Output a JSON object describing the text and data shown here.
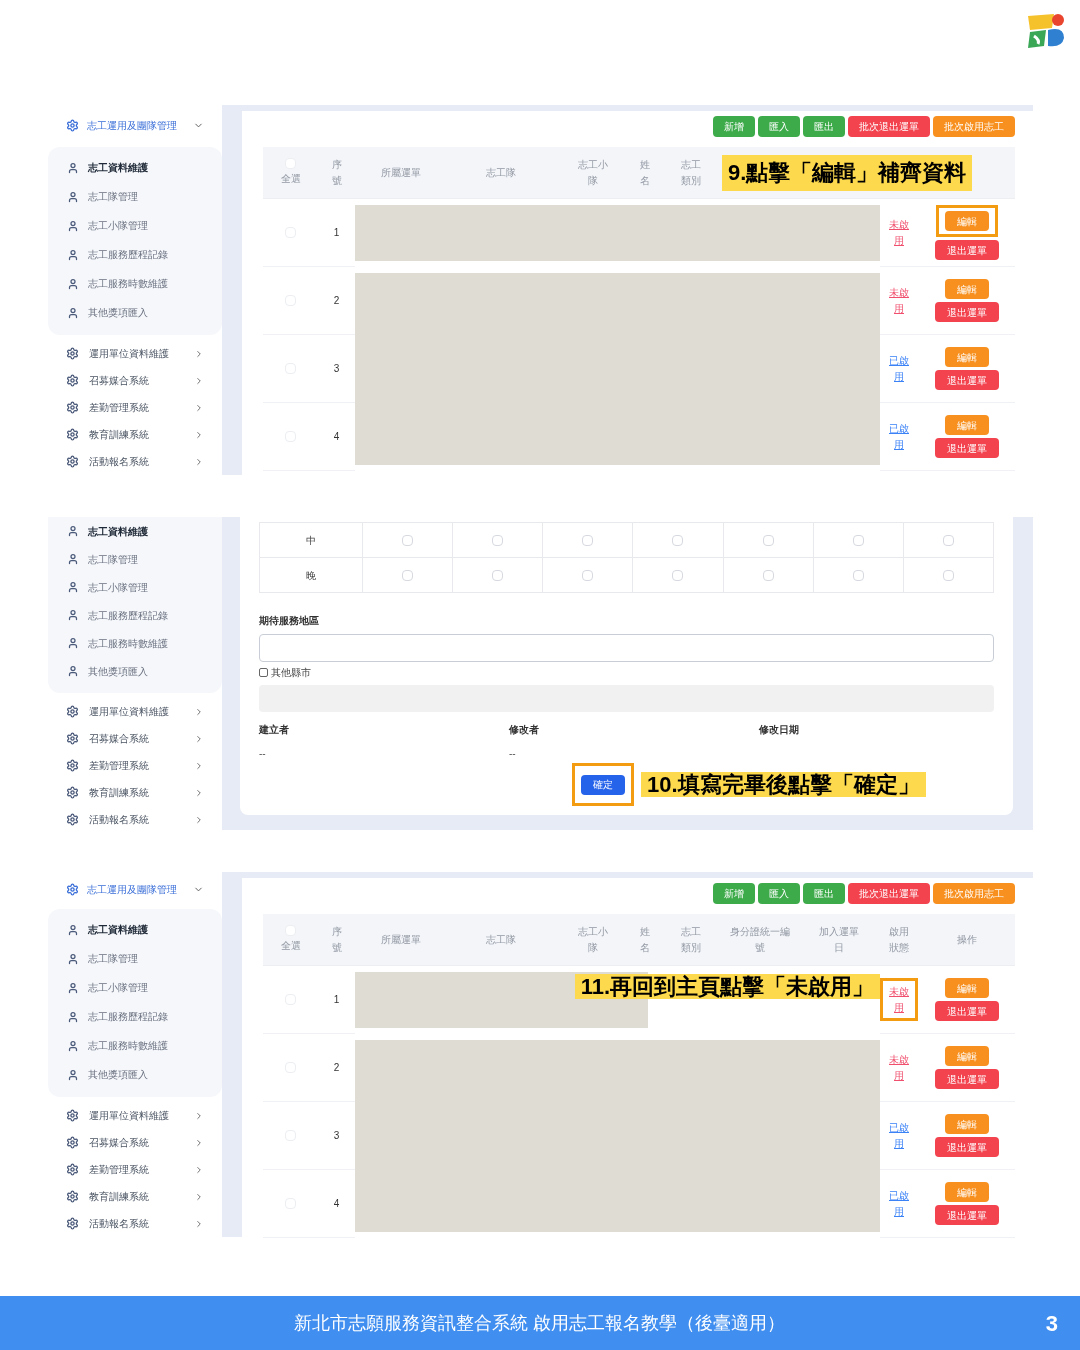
{
  "screenshot_1": {
    "sidebar": {
      "group": {
        "label": "志工運用及團隊管理",
        "expanded": true
      },
      "items": [
        {
          "label": "志工資料維護",
          "selected": true
        },
        {
          "label": "志工隊管理",
          "selected": false
        },
        {
          "label": "志工小隊管理",
          "selected": false
        },
        {
          "label": "志工服務歷程記錄",
          "selected": false
        },
        {
          "label": "志工服務時數維護",
          "selected": false
        },
        {
          "label": "其他獎項匯入",
          "selected": false
        }
      ],
      "other_groups": [
        {
          "label": "運用單位資料維護",
          "expanded": false
        },
        {
          "label": "召募媒合系統",
          "expanded": false
        },
        {
          "label": "差勤管理系統",
          "expanded": false
        },
        {
          "label": "教育訓練系統",
          "expanded": false
        },
        {
          "label": "活動報名系統",
          "expanded": false
        }
      ]
    },
    "toolbar": [
      {
        "label": "新增",
        "kind": "success"
      },
      {
        "label": "匯入",
        "kind": "success"
      },
      {
        "label": "匯出",
        "kind": "success"
      },
      {
        "label": "批次退出運單",
        "kind": "danger"
      },
      {
        "label": "批次啟用志工",
        "kind": "warning"
      }
    ],
    "table": {
      "columns": [
        {
          "label": "全選",
          "kind": "select_all",
          "checked": false
        },
        {
          "label": "序號"
        },
        {
          "label": "所屬運單"
        },
        {
          "label": "志工隊"
        },
        {
          "label": "志工小隊"
        },
        {
          "label": "姓名"
        },
        {
          "label": "志工類別"
        }
      ],
      "header_callout": "9.點擊「編輯」補齊資料",
      "rows": [
        {
          "number": "1",
          "checked": false,
          "status": "未啟用",
          "enabled": false,
          "edit_highlighted": true,
          "status_highlighted": false,
          "actions": [
            {
              "label": "編輯",
              "kind": "warning"
            },
            {
              "label": "退出運單",
              "kind": "danger"
            }
          ]
        },
        {
          "number": "2",
          "checked": false,
          "status": "未啟用",
          "enabled": false,
          "edit_highlighted": false,
          "status_highlighted": false,
          "actions": [
            {
              "label": "編輯",
              "kind": "warning"
            },
            {
              "label": "退出運單",
              "kind": "danger"
            }
          ]
        },
        {
          "number": "3",
          "checked": false,
          "status": "已啟用",
          "enabled": true,
          "edit_highlighted": false,
          "status_highlighted": false,
          "actions": [
            {
              "label": "編輯",
              "kind": "warning"
            },
            {
              "label": "退出運單",
              "kind": "danger"
            }
          ]
        },
        {
          "number": "4",
          "checked": false,
          "status": "已啟用",
          "enabled": true,
          "edit_highlighted": false,
          "status_highlighted": false,
          "actions": [
            {
              "label": "編輯",
              "kind": "warning"
            },
            {
              "label": "退出運單",
              "kind": "danger"
            }
          ]
        }
      ]
    }
  },
  "screenshot_2": {
    "sidebar": {
      "items": [
        {
          "label": "志工資料維護",
          "selected": true
        },
        {
          "label": "志工隊管理",
          "selected": false
        },
        {
          "label": "志工小隊管理",
          "selected": false
        },
        {
          "label": "志工服務歷程記錄",
          "selected": false
        },
        {
          "label": "志工服務時數維護",
          "selected": false
        },
        {
          "label": "其他獎項匯入",
          "selected": false
        }
      ],
      "other_groups": [
        {
          "label": "運用單位資料維護",
          "expanded": false
        },
        {
          "label": "召募媒合系統",
          "expanded": false
        },
        {
          "label": "差勤管理系統",
          "expanded": false
        },
        {
          "label": "教育訓練系統",
          "expanded": false
        },
        {
          "label": "活動報名系統",
          "expanded": false
        }
      ]
    },
    "schedule_rows": [
      {
        "label": "中",
        "slots": [
          false,
          false,
          false,
          false,
          false,
          false,
          false
        ]
      },
      {
        "label": "晚",
        "slots": [
          false,
          false,
          false,
          false,
          false,
          false,
          false
        ]
      }
    ],
    "service_area": {
      "label": "期待服務地區"
    },
    "other_county": {
      "label": "其他縣市",
      "checked": false
    },
    "other_county_field": {
      "disabled": true
    },
    "meta": [
      {
        "label": "建立者",
        "value": "--"
      },
      {
        "label": "修改者",
        "value": "--"
      },
      {
        "label": "修改日期"
      }
    ],
    "confirm_button": {
      "label": "確定",
      "highlighted": true
    },
    "callout": "10.填寫完畢後點擊「確定」"
  },
  "screenshot_3": {
    "sidebar": {
      "group": {
        "label": "志工運用及團隊管理",
        "expanded": true
      },
      "items": [
        {
          "label": "志工資料維護",
          "selected": true
        },
        {
          "label": "志工隊管理",
          "selected": false
        },
        {
          "label": "志工小隊管理",
          "selected": false
        },
        {
          "label": "志工服務歷程記錄",
          "selected": false
        },
        {
          "label": "志工服務時數維護",
          "selected": false
        },
        {
          "label": "其他獎項匯入",
          "selected": false
        }
      ],
      "other_groups": [
        {
          "label": "運用單位資料維護",
          "expanded": false
        },
        {
          "label": "召募媒合系統",
          "expanded": false
        },
        {
          "label": "差勤管理系統",
          "expanded": false
        },
        {
          "label": "教育訓練系統",
          "expanded": false
        },
        {
          "label": "活動報名系統",
          "expanded": false
        }
      ]
    },
    "toolbar": [
      {
        "label": "新增",
        "kind": "success"
      },
      {
        "label": "匯入",
        "kind": "success"
      },
      {
        "label": "匯出",
        "kind": "success"
      },
      {
        "label": "批次退出運單",
        "kind": "danger"
      },
      {
        "label": "批次啟用志工",
        "kind": "warning"
      }
    ],
    "table": {
      "columns": [
        {
          "label": "全選",
          "kind": "select_all",
          "checked": false
        },
        {
          "label": "序號"
        },
        {
          "label": "所屬運單"
        },
        {
          "label": "志工隊"
        },
        {
          "label": "志工小隊"
        },
        {
          "label": "姓名"
        },
        {
          "label": "志工類別"
        },
        {
          "label": "身分證統一編號"
        },
        {
          "label": "加入運單日"
        },
        {
          "label": "啟用狀態"
        },
        {
          "label": "操作"
        }
      ],
      "rows": [
        {
          "number": "1",
          "checked": false,
          "status": "未啟用",
          "enabled": false,
          "edit_highlighted": false,
          "status_highlighted": true,
          "callout": "11.再回到主頁點擊「未啟用」",
          "actions": [
            {
              "label": "編輯",
              "kind": "warning"
            },
            {
              "label": "退出運單",
              "kind": "danger"
            }
          ]
        },
        {
          "number": "2",
          "checked": false,
          "status": "未啟用",
          "enabled": false,
          "edit_highlighted": false,
          "status_highlighted": false,
          "actions": [
            {
              "label": "編輯",
              "kind": "warning"
            },
            {
              "label": "退出運單",
              "kind": "danger"
            }
          ]
        },
        {
          "number": "3",
          "checked": false,
          "status": "已啟用",
          "enabled": true,
          "edit_highlighted": false,
          "status_highlighted": false,
          "actions": [
            {
              "label": "編輯",
              "kind": "warning"
            },
            {
              "label": "退出運單",
              "kind": "danger"
            }
          ]
        },
        {
          "number": "4",
          "checked": false,
          "status": "已啟用",
          "enabled": true,
          "edit_highlighted": false,
          "status_highlighted": false,
          "actions": [
            {
              "label": "編輯",
              "kind": "warning"
            },
            {
              "label": "退出運單",
              "kind": "danger"
            }
          ]
        }
      ]
    }
  },
  "footer": {
    "title": "新北市志願服務資訊整合系統 啟用志工報名教學（後臺適用）",
    "page": "3"
  }
}
